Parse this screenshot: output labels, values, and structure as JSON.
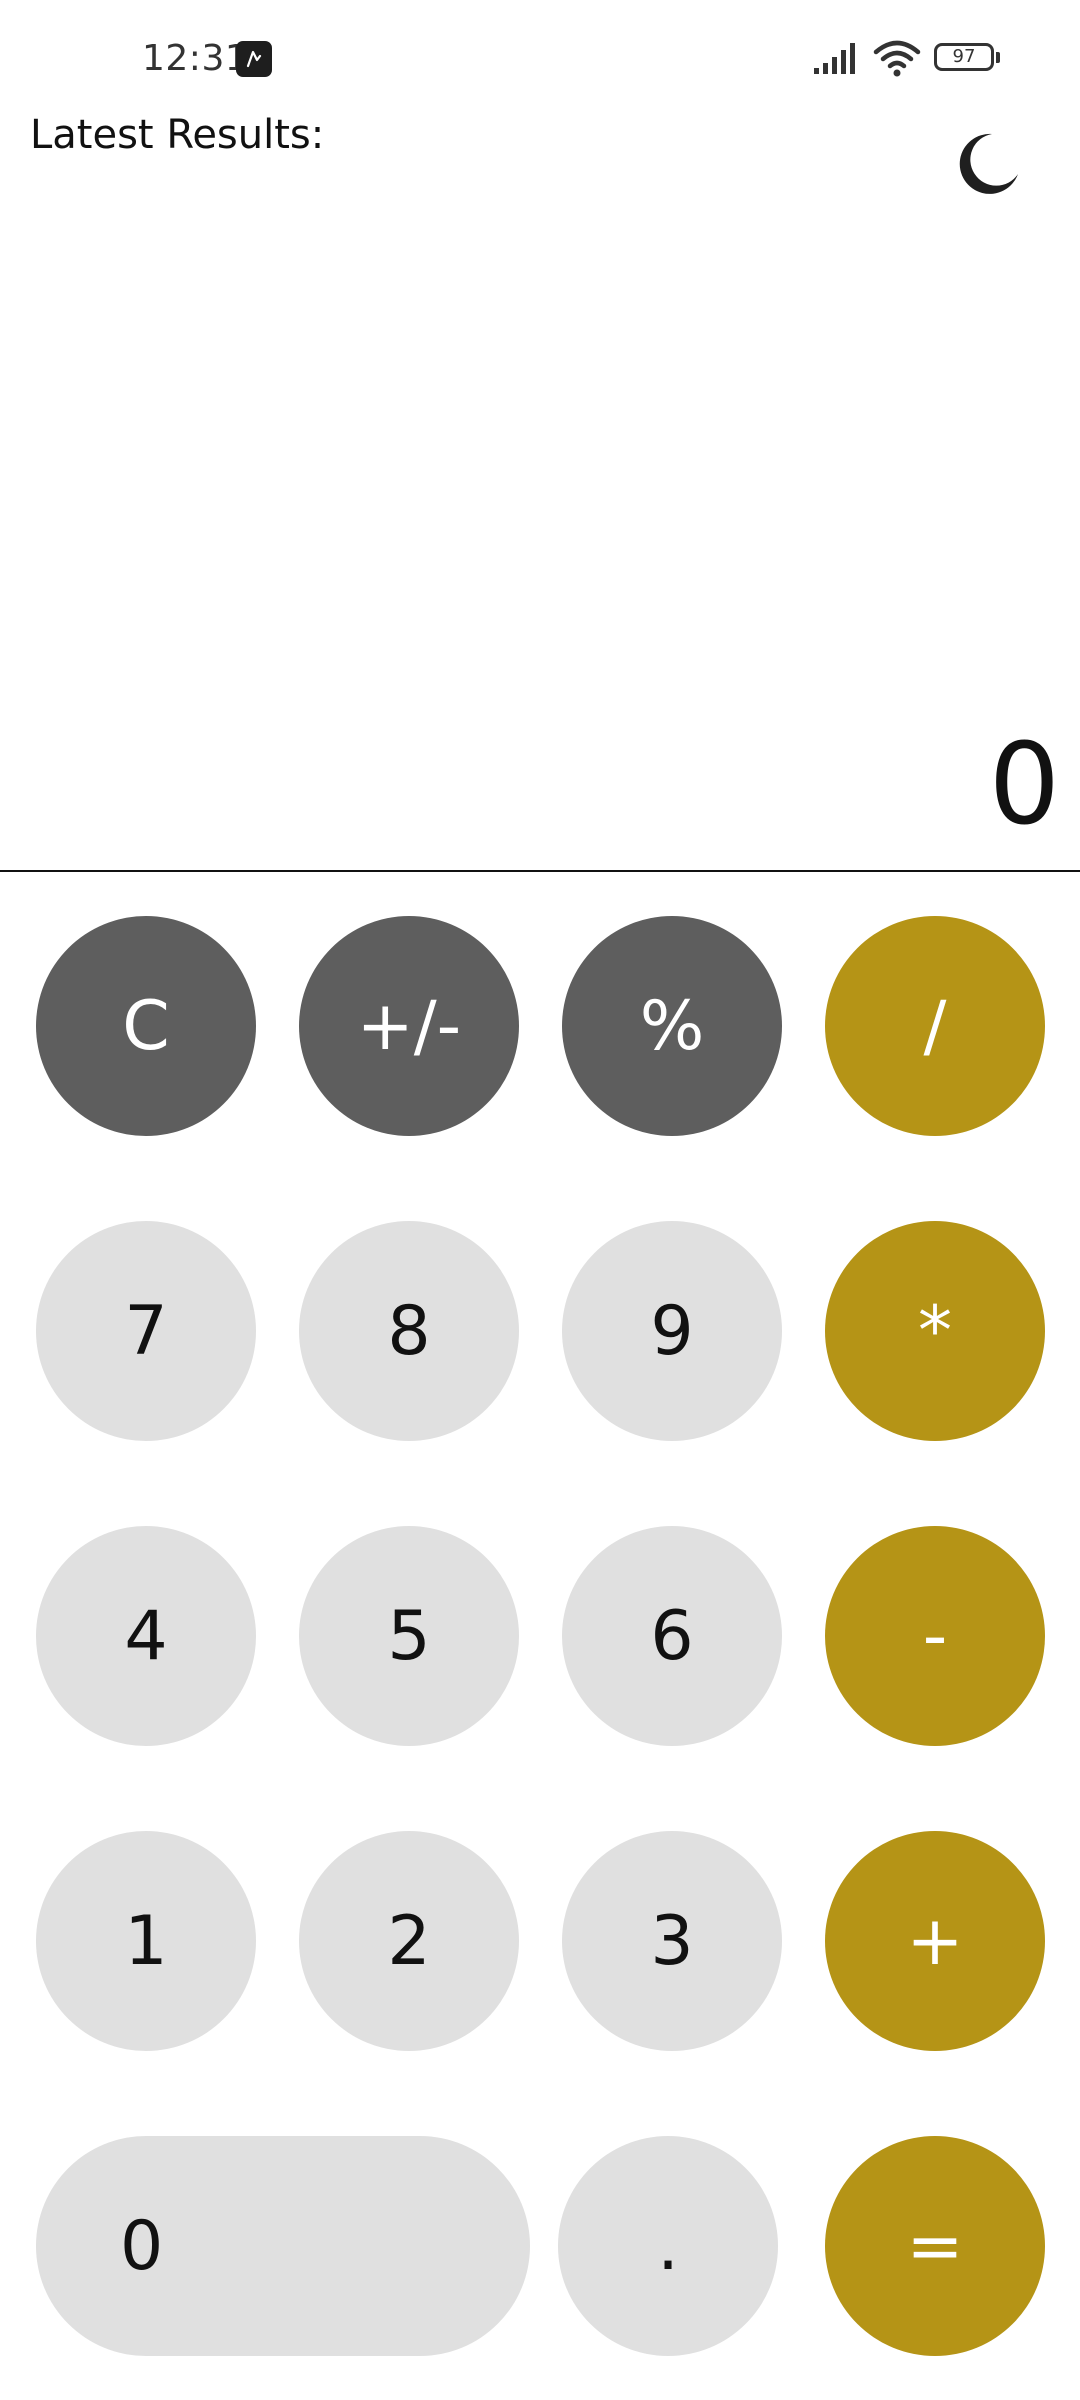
{
  "status_bar": {
    "time": "12:31",
    "battery": "97",
    "icons": [
      "app-notification-icon",
      "signal-icon",
      "wifi-icon",
      "battery-icon"
    ]
  },
  "header": {
    "latest_results_label": "Latest Results:",
    "theme_toggle_icon": "moon-icon"
  },
  "display": {
    "value": "0"
  },
  "keypad": {
    "clear": "C",
    "sign": "+/-",
    "percent": "%",
    "divide": "/",
    "seven": "7",
    "eight": "8",
    "nine": "9",
    "multiply": "*",
    "four": "4",
    "five": "5",
    "six": "6",
    "subtract": "-",
    "one": "1",
    "two": "2",
    "three": "3",
    "add": "+",
    "zero": "0",
    "decimal": ".",
    "equals": "="
  },
  "colors": {
    "function_key": "#5e5e5e",
    "number_key": "#e0e0e0",
    "operator_key": "#b59416",
    "background": "#ffffff"
  }
}
